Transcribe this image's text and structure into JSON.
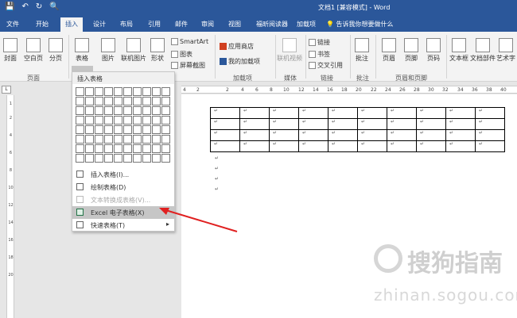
{
  "window": {
    "title": "文档1 [兼容模式] - Word"
  },
  "quick_access": {
    "save": "💾",
    "undo": "↶",
    "redo": "↻",
    "preview": "🔍"
  },
  "tabs": [
    "文件",
    "开始",
    "插入",
    "设计",
    "布局",
    "引用",
    "邮件",
    "审阅",
    "视图",
    "福昕阅读器",
    "加载项"
  ],
  "tell_me": "告诉我你想要做什么",
  "ribbon": {
    "cover": "封面",
    "blank": "空白页",
    "break": "分页",
    "pages_group": "页面",
    "table": "表格",
    "picture": "图片",
    "online_picture": "联机图片",
    "shapes": "形状",
    "smartart": "SmartArt",
    "chart": "图表",
    "screenshot": "屏幕截图",
    "store": "应用商店",
    "my_addins": "我的加载项",
    "addins_group": "加载项",
    "online_video": "联机视频",
    "media_group": "媒体",
    "link": "链接",
    "bookmark": "书签",
    "crossref": "交叉引用",
    "links_group": "链接",
    "comment": "批注",
    "comments_group": "批注",
    "header": "页眉",
    "footer": "页脚",
    "page_number": "页码",
    "hf_group": "页眉和页脚",
    "textbox": "文本框",
    "quick_parts": "文档部件",
    "wordart": "艺术字"
  },
  "dropdown": {
    "header": "插入表格",
    "items": [
      {
        "label": "插入表格(I)...",
        "disabled": false
      },
      {
        "label": "绘制表格(D)",
        "disabled": false
      },
      {
        "label": "文本转换成表格(V)...",
        "disabled": true
      },
      {
        "label": "Excel 电子表格(X)",
        "disabled": false
      },
      {
        "label": "快速表格(T)",
        "disabled": false
      }
    ],
    "submenu_arrow": "▸"
  },
  "ruler": {
    "marks": [
      "4",
      "2",
      "2",
      "4",
      "6",
      "8",
      "10",
      "12",
      "14",
      "16",
      "18",
      "20",
      "22",
      "24",
      "26",
      "28",
      "30",
      "32",
      "34",
      "36",
      "38",
      "40"
    ]
  },
  "vruler": {
    "marks": [
      "1",
      "2",
      "4",
      "6",
      "8",
      "10",
      "12",
      "14",
      "16",
      "18",
      "20"
    ]
  },
  "ruler_corner": "L",
  "document": {
    "paragraph_mark": "↵"
  },
  "watermark": {
    "text": "搜狗指南",
    "url": "zhinan.sogou.com"
  },
  "colors": {
    "titlebar": "#2b579a",
    "highlight": "#c6c6c6",
    "arrow": "#e02020"
  }
}
